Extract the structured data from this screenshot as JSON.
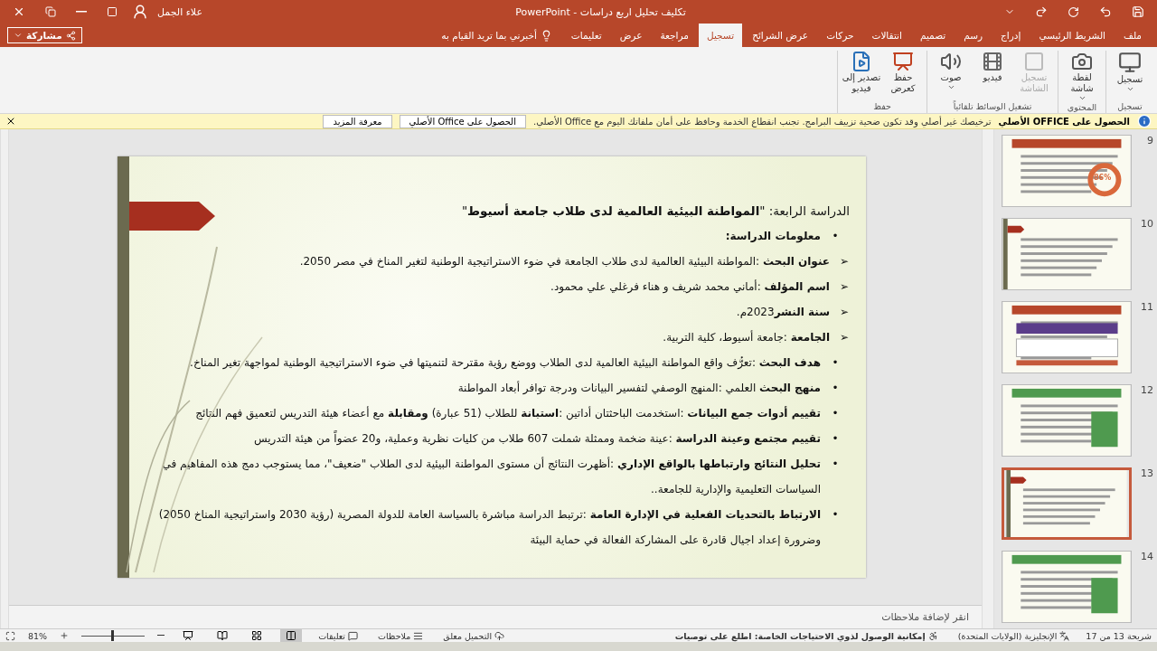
{
  "window": {
    "title": "تكليف تحليل اربع دراسات  -  PowerPoint",
    "user": "علاء الجمل",
    "share": "مشاركة"
  },
  "tabs": [
    {
      "label": "ملف",
      "selected": false
    },
    {
      "label": "الشريط الرئيسي",
      "selected": false
    },
    {
      "label": "إدراج",
      "selected": false
    },
    {
      "label": "رسم",
      "selected": false
    },
    {
      "label": "تصميم",
      "selected": false
    },
    {
      "label": "انتقالات",
      "selected": false
    },
    {
      "label": "حركات",
      "selected": false
    },
    {
      "label": "عرض الشرائح",
      "selected": false
    },
    {
      "label": "تسجيل",
      "selected": true
    },
    {
      "label": "مراجعة",
      "selected": false
    },
    {
      "label": "عرض",
      "selected": false
    },
    {
      "label": "تعليمات",
      "selected": false
    }
  ],
  "tell_me": {
    "placeholder": "أخبرني بما تريد القيام به"
  },
  "ribbon_groups": [
    {
      "label": "تسجيل",
      "buttons": [
        {
          "kind": "record",
          "label": "تسجيل",
          "disabled": false,
          "dropdown": true
        }
      ]
    },
    {
      "label": "المحتوى",
      "buttons": [
        {
          "kind": "screenshot",
          "label": "لقطة شاشة",
          "disabled": false,
          "dropdown": true
        }
      ]
    },
    {
      "label": "تشغيل الوسائط تلقائياً",
      "buttons": [
        {
          "kind": "screen-record",
          "label": "تسجيل الشاشة",
          "disabled": true,
          "dropdown": false
        },
        {
          "kind": "video",
          "label": "فيديو",
          "disabled": false,
          "dropdown": false
        },
        {
          "kind": "audio",
          "label": "صوت",
          "disabled": false,
          "dropdown": true
        }
      ]
    },
    {
      "label": "حفظ",
      "buttons": [
        {
          "kind": "save-show",
          "label": "حفظ كعرض",
          "disabled": false,
          "dropdown": false
        },
        {
          "kind": "export-video",
          "label": "تصدير إلى فيديو",
          "disabled": false,
          "dropdown": false
        }
      ]
    }
  ],
  "info_bar": {
    "title": "الحصول على OFFICE الأصلي",
    "message": "ترخيصك غير أصلي وقد تكون ضحية تزييف البرامج. تجنب انقطاع الخدمة وحافظ على أمان ملفاتك اليوم مع Office الأصلي.",
    "buttons": [
      "الحصول على Office الأصلي",
      "معرفة المزيد"
    ]
  },
  "slide": {
    "title": "الدراسة الرابعة: \"**المواطنة البيئية العالمية لدى طلاب جامعة أسيوط**\"",
    "items": [
      {
        "kind": "heading",
        "bullet": "•",
        "text": "**معلومات الدراسة:**"
      },
      {
        "kind": "arrow",
        "bullet": "➢",
        "text": "**عنوان البحث** :المواطنة البيئية العالمية لدى طلاب الجامعة في ضوء الاستراتيجية الوطنية لتغير المناخ في مصر 2050."
      },
      {
        "kind": "arrow",
        "bullet": "➢",
        "text": "**اسم المؤلف** :أماني محمد شريف و هناء فرغلي علي محمود."
      },
      {
        "kind": "arrow",
        "bullet": "➢",
        "text": "**سنة النشر**2023م."
      },
      {
        "kind": "arrow",
        "bullet": "➢",
        "text": "**الجامعة** :جامعة أسيوط، كلية التربية."
      },
      {
        "kind": "dot",
        "bullet": "•",
        "text": "**هدف البحث** :تعرُّف واقع المواطنة البيئية العالمية لدى الطلاب ووضع رؤية مقترحة لتنميتها في ضوء الاستراتيجية الوطنية لمواجهة تغير المناخ."
      },
      {
        "kind": "dot",
        "bullet": "•",
        "text": "**منهج البحث** العلمي :المنهج الوصفي لتفسير البيانات ودرجة توافر أبعاد المواطنة"
      },
      {
        "kind": "dot",
        "bullet": "•",
        "text": "**تقييم أدوات جمع البيانات** :استخدمت الباحثتان أداتين :**استبانة** للطلاب (51 عبارة) **ومقابلة** مع أعضاء هيئة التدريس لتعميق فهم النتائج"
      },
      {
        "kind": "dot",
        "bullet": "•",
        "text": "**تقييم مجتمع وعينة الدراسة** :عينة ضخمة وممثلة شملت 607 طلاب من كليات نظرية وعملية، و20 عضواً من هيئة التدريس"
      },
      {
        "kind": "dot",
        "bullet": "•",
        "text": "**تحليل النتائج وارتباطها بالواقع الإداري** :أظهرت النتائج أن مستوى المواطنة البيئية لدى الطلاب \"ضعيف\"، مما يستوجب دمج هذه المفاهيم في السياسات التعليمية والإدارية للجامعة.."
      },
      {
        "kind": "dot",
        "bullet": "•",
        "text": "**الارتباط بالتحديات الفعلية في الإدارة العامة** :ترتبط الدراسة مباشرة بالسياسة العامة للدولة المصرية (رؤية 2030 واستراتيجية المناخ 2050) وضرورة إعداد اجيال قادرة على المشاركة الفعالة في حماية البيئة"
      }
    ]
  },
  "thumbnails": [
    {
      "number": "9",
      "selected": false,
      "kind": "ring",
      "badge": "86%"
    },
    {
      "number": "10",
      "selected": false,
      "kind": "text"
    },
    {
      "number": "11",
      "selected": false,
      "kind": "cards"
    },
    {
      "number": "12",
      "selected": false,
      "kind": "chart"
    },
    {
      "number": "13",
      "selected": true,
      "kind": "text"
    },
    {
      "number": "14",
      "selected": false,
      "kind": "chart"
    }
  ],
  "notes": {
    "placeholder": "انقر لإضافة ملاحظات"
  },
  "status_bar": {
    "slide": "شريحة 13 من 17",
    "language": "الإنجليزية (الولايات المتحدة)",
    "accessibility": "إمكانية الوصول لذوي الاحتياجات الخاصة: اطلع على توصيات",
    "upload": "التحميل معلق",
    "notes": "ملاحظات",
    "comments": "تعليقات",
    "views": [
      {
        "kind": "normal",
        "selected": true
      },
      {
        "kind": "sorter",
        "selected": false
      },
      {
        "kind": "reading",
        "selected": false
      },
      {
        "kind": "slideshow",
        "selected": false
      }
    ],
    "zoom": {
      "level": 0.5,
      "reading": "81%"
    }
  }
}
